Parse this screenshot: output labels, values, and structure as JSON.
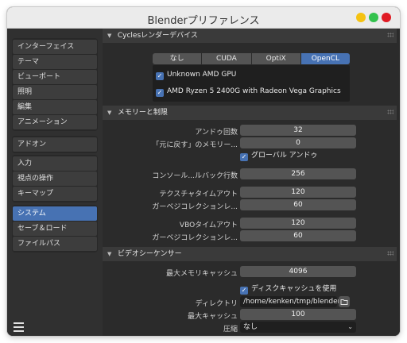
{
  "window": {
    "title": "Blenderプリファレンス"
  },
  "sidebar": {
    "groups": [
      [
        "インターフェイス",
        "テーマ",
        "ビューポート",
        "照明",
        "編集",
        "アニメーション"
      ],
      [
        "アドオン"
      ],
      [
        "入力",
        "視点の操作",
        "キーマップ"
      ],
      [
        "システム",
        "セーブ＆ロード",
        "ファイルパス"
      ]
    ],
    "active": "システム"
  },
  "cycles": {
    "header": "Cyclesレンダーデバイス",
    "tabs": [
      "なし",
      "CUDA",
      "OptiX",
      "OpenCL"
    ],
    "active_tab": "OpenCL",
    "devices": [
      "Unknown AMD GPU",
      "AMD Ryzen 5 2400G with Radeon Vega Graphics"
    ]
  },
  "memory": {
    "header": "メモリーと制限",
    "undo_steps_label": "アンドゥ回数",
    "undo_steps": "32",
    "undo_memory_label": "「元に戻す」のメモリー...",
    "undo_memory": "0",
    "global_undo_label": "グローバル アンドゥ",
    "console_scrollback_label": "コンソール...ルバック行数",
    "console_scrollback": "256",
    "texture_timeout_label": "テクスチャタイムアウト",
    "texture_timeout": "120",
    "texture_gc_label": "ガーベジコレクションレ...",
    "texture_gc": "60",
    "vbo_timeout_label": "VBOタイムアウト",
    "vbo_timeout": "120",
    "vbo_gc_label": "ガーベジコレクションレ...",
    "vbo_gc": "60"
  },
  "video": {
    "header": "ビデオシーケンサー",
    "memory_cache_label": "最大メモリキャッシュ",
    "memory_cache": "4096",
    "disk_cache_label": "ディスクキャッシュを使用",
    "directory_label": "ディレクトリ",
    "directory": "/home/kenken/tmp/blender/",
    "max_cache_label": "最大キャッシュ",
    "max_cache": "100",
    "compression_label": "圧縮",
    "compression": "なし"
  },
  "colors": {
    "accent": "#4772b3",
    "panel": "#303030",
    "field": "#545454"
  }
}
